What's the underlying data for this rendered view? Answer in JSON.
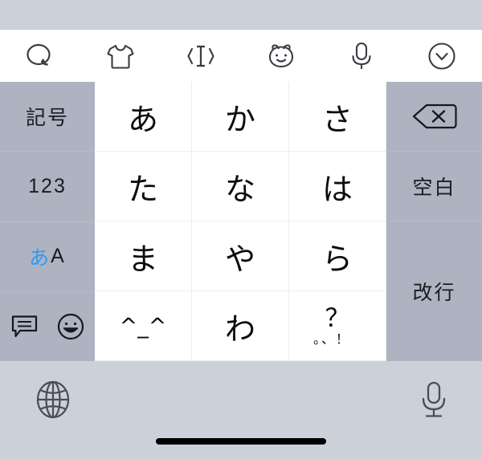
{
  "app": {
    "name": "iOS Japanese Kana Keyboard",
    "accent_color": "#2e9bf0",
    "key_bg": "#ffffff",
    "function_key_bg": "#aeb3c2",
    "chrome_bg": "#ccd0d8"
  },
  "toolbar": {
    "items": [
      {
        "name": "search-bubble-icon",
        "label": "検索"
      },
      {
        "name": "sticker-shirt-icon",
        "label": "ステッカー"
      },
      {
        "name": "cursor-move-icon",
        "label": "カーソル移動"
      },
      {
        "name": "kaomoji-face-icon",
        "label": "顔文字"
      },
      {
        "name": "microphone-icon",
        "label": "音声入力"
      },
      {
        "name": "chevron-down-circle-icon",
        "label": "閉じる"
      }
    ]
  },
  "left_column": {
    "keys": [
      {
        "name": "symbols-key",
        "label": "記号"
      },
      {
        "name": "numeric-key",
        "label": "123"
      },
      {
        "name": "input-mode-key",
        "hiragana": "あ",
        "latin": "A"
      }
    ],
    "icon_row": [
      {
        "name": "suggestions-bubble-icon",
        "label": "変換候補"
      },
      {
        "name": "emoji-smiley-icon",
        "label": "絵文字"
      }
    ]
  },
  "kana_grid": {
    "rows": [
      [
        "あ",
        "か",
        "さ"
      ],
      [
        "た",
        "な",
        "は"
      ],
      [
        "ま",
        "や",
        "ら"
      ]
    ],
    "last_row": {
      "kaomoji": "^_^",
      "wa": "わ",
      "punct_big": "？",
      "punct_small": "。、！"
    }
  },
  "right_column": {
    "delete": {
      "name": "delete-key",
      "label": "削除"
    },
    "space": {
      "name": "space-key",
      "label": "空白"
    },
    "return": {
      "name": "return-key",
      "label": "改行"
    }
  },
  "bottom_bar": {
    "globe": {
      "name": "globe-key",
      "label": "次のキーボード"
    },
    "dictation": {
      "name": "dictation-mic-key",
      "label": "音声入力"
    },
    "home_indicator": {
      "name": "home-indicator",
      "label": "ホームインジケータ"
    }
  }
}
